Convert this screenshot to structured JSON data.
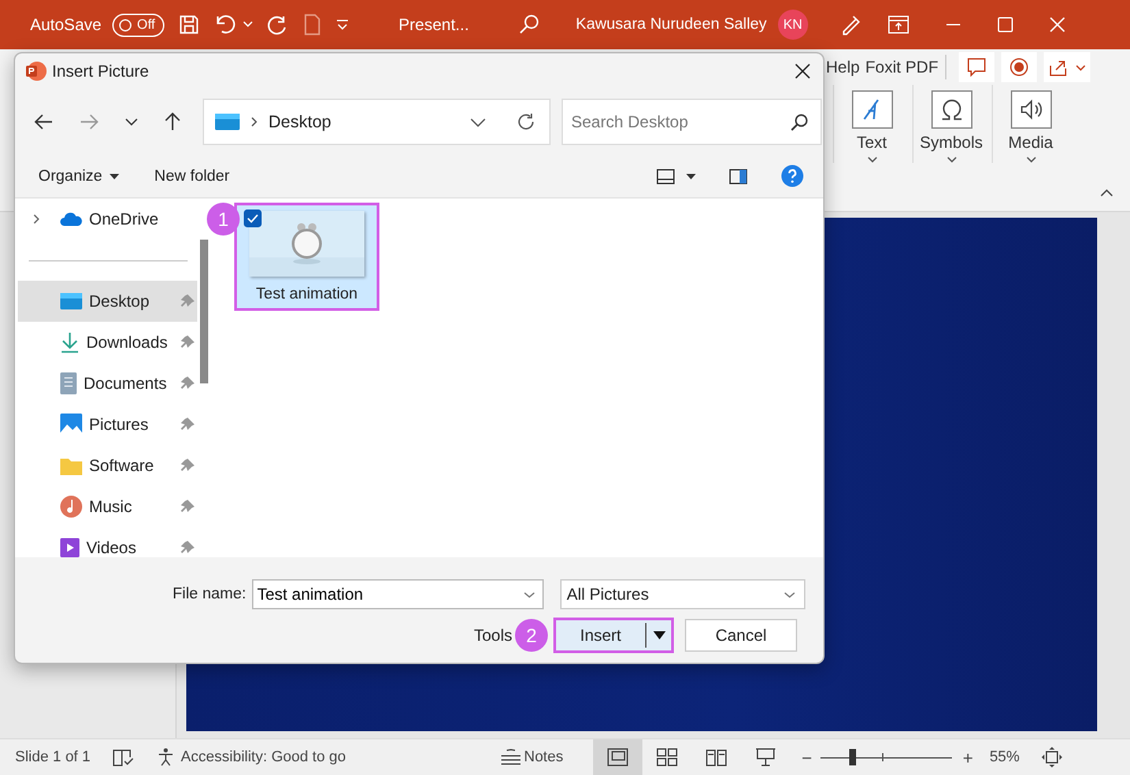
{
  "app_titlebar": {
    "autosave_label": "AutoSave",
    "autosave_toggle": {
      "label": "Off",
      "on": false
    },
    "document_title": "Present...",
    "user_name": "Kawusara Nurudeen Salley",
    "user_initials": "KN"
  },
  "ribbon": {
    "tabs": [
      {
        "label": "Help"
      },
      {
        "label": "Foxit PDF"
      }
    ],
    "groups": [
      {
        "label": "Text",
        "kind": "text"
      },
      {
        "label": "Symbols",
        "kind": "symbols"
      },
      {
        "label": "Media",
        "kind": "media"
      }
    ]
  },
  "dialog": {
    "title": "Insert Picture",
    "breadcrumb": "Desktop",
    "search": {
      "placeholder": "Search Desktop"
    },
    "organize": "Organize",
    "new_folder": "New folder",
    "sidebar": [
      {
        "label": "OneDrive",
        "kind": "cloud",
        "pinned": false,
        "selected": false,
        "expanded": false
      },
      {
        "label": "Desktop",
        "kind": "desktop",
        "pinned": true,
        "selected": true
      },
      {
        "label": "Downloads",
        "kind": "download",
        "pinned": true,
        "selected": false
      },
      {
        "label": "Documents",
        "kind": "document",
        "pinned": true,
        "selected": false
      },
      {
        "label": "Pictures",
        "kind": "picture",
        "pinned": true,
        "selected": false
      },
      {
        "label": "Software",
        "kind": "folder",
        "pinned": true,
        "selected": false
      },
      {
        "label": "Music",
        "kind": "music",
        "pinned": true,
        "selected": false
      },
      {
        "label": "Videos",
        "kind": "video",
        "pinned": true,
        "selected": false
      }
    ],
    "files": [
      {
        "name": "Test animation",
        "checked": true,
        "selected": true,
        "highlighted": true,
        "callout": "1"
      }
    ],
    "file_name": {
      "label": "File name:",
      "value": "Test animation"
    },
    "file_type": "All Pictures",
    "tools": "Tools",
    "insert": {
      "label": "Insert",
      "callout": "2",
      "highlighted": true
    },
    "cancel": "Cancel"
  },
  "status_bar": {
    "slide": "Slide 1 of 1",
    "accessibility": "Accessibility: Good to go",
    "notes": "Notes",
    "views": [
      {
        "kind": "normal",
        "selected": true
      },
      {
        "kind": "sorter",
        "selected": false
      },
      {
        "kind": "reading",
        "selected": false
      },
      {
        "kind": "slideshow",
        "selected": false
      }
    ],
    "zoom_out": "−",
    "zoom_in": "+",
    "zoom": {
      "level": 0.25,
      "reading": "55%"
    }
  }
}
